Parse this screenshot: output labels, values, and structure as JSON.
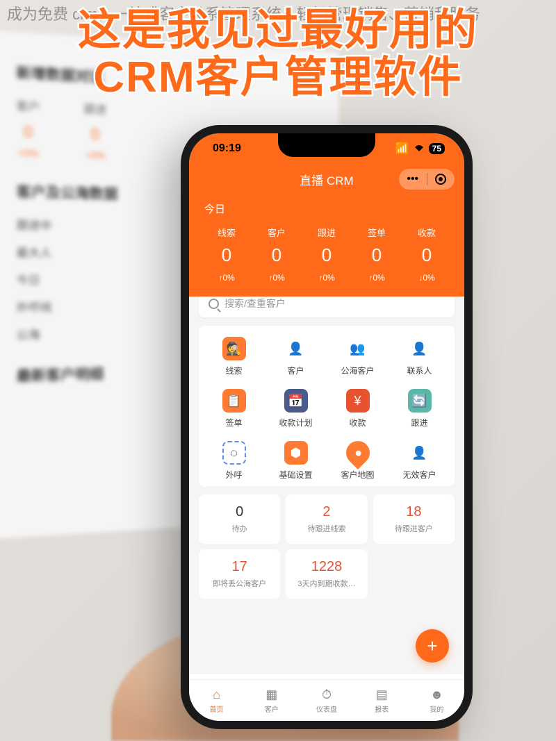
{
  "watermark": "成为免费 crm，一站式客户关系管理系统，轻松管理销售、营销和服务",
  "headline_line1": "这是我见过最好用的",
  "headline_line2": "CRM客户管理软件",
  "desktop": {
    "section1_title": "新增数据对比",
    "cols": [
      {
        "label": "客户",
        "value": "0",
        "pct": "+0%"
      },
      {
        "label": "跟进",
        "value": "0",
        "pct": "+0%"
      }
    ],
    "section2_title": "客户及公海数据",
    "list": [
      "跟进中",
      "最大人",
      "今日",
      "外呼线",
      "公海"
    ],
    "section3_title": "最新客户明细"
  },
  "status": {
    "time": "09:19",
    "battery": "75"
  },
  "header": {
    "title": "直播 CRM"
  },
  "stats": {
    "day_label": "今日",
    "items": [
      {
        "label": "线索",
        "value": "0",
        "pct": "↑0%"
      },
      {
        "label": "客户",
        "value": "0",
        "pct": "↑0%"
      },
      {
        "label": "跟进",
        "value": "0",
        "pct": "↑0%"
      },
      {
        "label": "签单",
        "value": "0",
        "pct": "↑0%"
      },
      {
        "label": "收款",
        "value": "0",
        "pct": "↓0%"
      }
    ]
  },
  "search": {
    "placeholder": "搜索/查重客户"
  },
  "modules": [
    {
      "name": "lead",
      "label": "线索",
      "icon": "🕵",
      "cls": "ic-orange"
    },
    {
      "name": "customer",
      "label": "客户",
      "icon": "👤",
      "cls": "ic-blue-person"
    },
    {
      "name": "public-customer",
      "label": "公海客户",
      "icon": "👥",
      "cls": "ic-blue-person"
    },
    {
      "name": "contact",
      "label": "联系人",
      "icon": "👤",
      "cls": "ic-blue-person"
    },
    {
      "name": "sign",
      "label": "签单",
      "icon": "📋",
      "cls": "ic-orange"
    },
    {
      "name": "payment-plan",
      "label": "收款计划",
      "icon": "📅",
      "cls": "ic-navy"
    },
    {
      "name": "payment",
      "label": "收款",
      "icon": "¥",
      "cls": "ic-red"
    },
    {
      "name": "followup",
      "label": "跟进",
      "icon": "🔄",
      "cls": "ic-teal"
    },
    {
      "name": "outbound",
      "label": "外呼",
      "icon": "◌",
      "cls": "ic-blue-circle"
    },
    {
      "name": "settings",
      "label": "基础设置",
      "icon": "⬢",
      "cls": "ic-orange-hex"
    },
    {
      "name": "customer-map",
      "label": "客户地图",
      "icon": "●",
      "cls": "ic-orange-pin"
    },
    {
      "name": "invalid",
      "label": "无效客户",
      "icon": "👤",
      "cls": "ic-gray"
    }
  ],
  "tasks": [
    {
      "num": "0",
      "label": "待办",
      "red": false
    },
    {
      "num": "2",
      "label": "待跟进线索",
      "red": true
    },
    {
      "num": "18",
      "label": "待跟进客户",
      "red": true
    },
    {
      "num": "17",
      "label": "即将丢公海客户",
      "red": true
    },
    {
      "num": "1228",
      "label": "3天内到期收款…",
      "red": true
    }
  ],
  "fab": "+",
  "nav": [
    {
      "name": "home",
      "label": "首页",
      "icon": "⌂",
      "active": true
    },
    {
      "name": "customers",
      "label": "客户",
      "icon": "▦",
      "active": false
    },
    {
      "name": "dashboard",
      "label": "仪表盘",
      "icon": "⏱",
      "active": false
    },
    {
      "name": "reports",
      "label": "报表",
      "icon": "▤",
      "active": false
    },
    {
      "name": "me",
      "label": "我的",
      "icon": "☻",
      "active": false
    }
  ]
}
